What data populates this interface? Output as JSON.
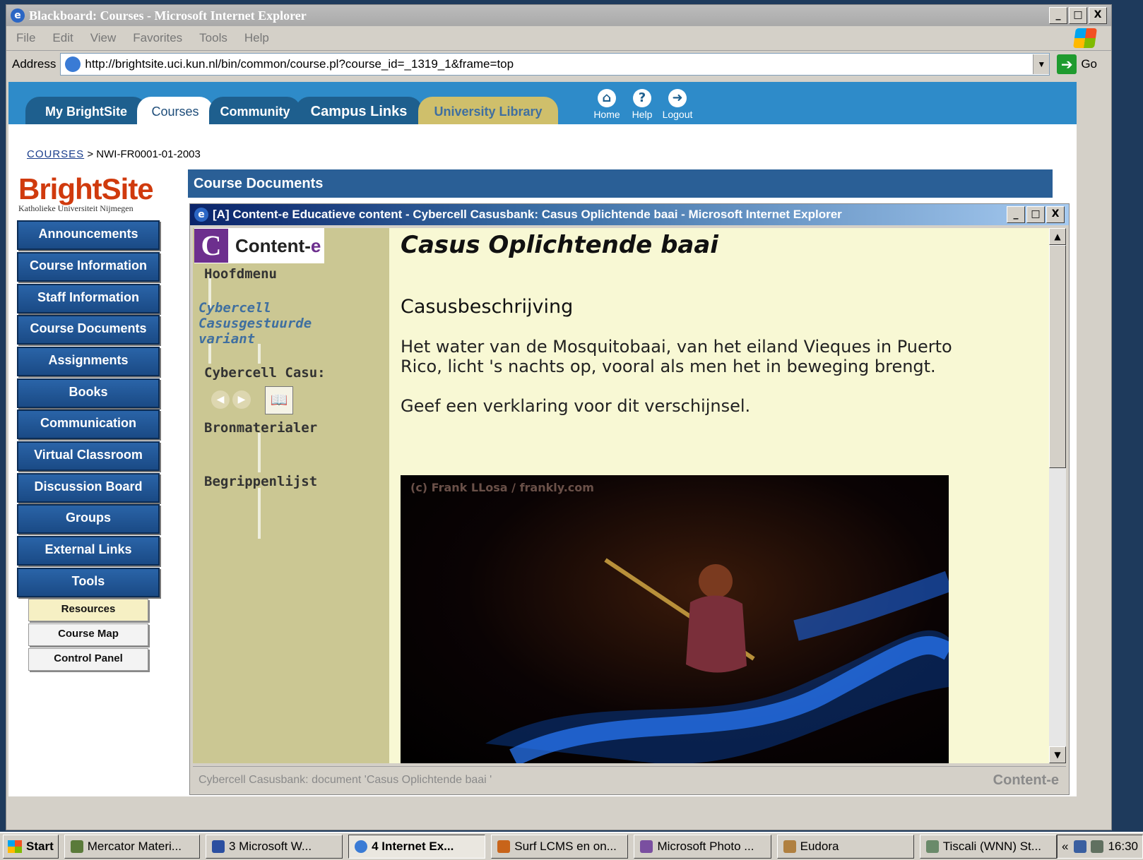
{
  "window": {
    "title": "Blackboard: Courses - Microsoft Internet Explorer",
    "minimize": "_",
    "maximize": "□",
    "close": "X"
  },
  "menu": [
    "File",
    "Edit",
    "View",
    "Favorites",
    "Tools",
    "Help"
  ],
  "address": {
    "label": "Address",
    "url": "http://brightsite.uci.kun.nl/bin/common/course.pl?course_id=_1319_1&frame=top",
    "go_label": "Go"
  },
  "tabs": {
    "my_brightsite": "My BrightSite",
    "courses": "Courses",
    "community": "Community",
    "campus_links": "Campus Links",
    "university_library": "University Library"
  },
  "header_icons": {
    "home": "Home",
    "help": "Help",
    "logout": "Logout"
  },
  "breadcrumb": {
    "root": "COURSES",
    "separator": ">",
    "current": "NWI-FR0001-01-2003"
  },
  "logo": {
    "name": "BrightSite",
    "subtitle": "Katholieke Universiteit Nijmegen"
  },
  "nav": [
    "Announcements",
    "Course Information",
    "Staff Information",
    "Course Documents",
    "Assignments",
    "Books",
    "Communication",
    "Virtual Classroom",
    "Discussion Board",
    "Groups",
    "External Links",
    "Tools"
  ],
  "tools": [
    "Resources",
    "Course Map",
    "Control Panel"
  ],
  "section_title": "Course Documents",
  "popup": {
    "title": "[A] Content-e Educatieve content - Cybercell Casusbank: Casus Oplichtende baai - Microsoft Internet Explorer",
    "logo_text": "Content-",
    "logo_e": "e",
    "menu": {
      "main": "Hoofdmenu",
      "link_1": "Cybercell",
      "link_2": "Casusgestuurde",
      "link_3": "variant",
      "case": "Cybercell Casu:",
      "sources": "Bronmaterialer",
      "glossary": "Begrippenlijst"
    },
    "content": {
      "title": "Casus Oplichtende baai",
      "subtitle": "Casusbeschrijving",
      "paragraph_1_line_1": "Het water van de Mosquitobaai, van het eiland Vieques in Puerto",
      "paragraph_1_line_2": "Rico, licht 's nachts op, vooral als men het in beweging brengt.",
      "paragraph_2": "Geef een verklaring voor dit verschijnsel.",
      "photo_credit": "(c) Frank LLosa / frankly.com"
    },
    "status_text": "Cybercell Casusbank: document 'Casus Oplichtende baai '",
    "status_brand": "Content-e"
  },
  "taskbar": {
    "start": "Start",
    "tasks": [
      "Mercator Materi...",
      "3 Microsoft W...",
      "4 Internet Ex...",
      "Surf LCMS en on...",
      "Microsoft Photo ...",
      "Eudora",
      "Tiscali (WNN) St..."
    ],
    "clock": "16:30"
  }
}
